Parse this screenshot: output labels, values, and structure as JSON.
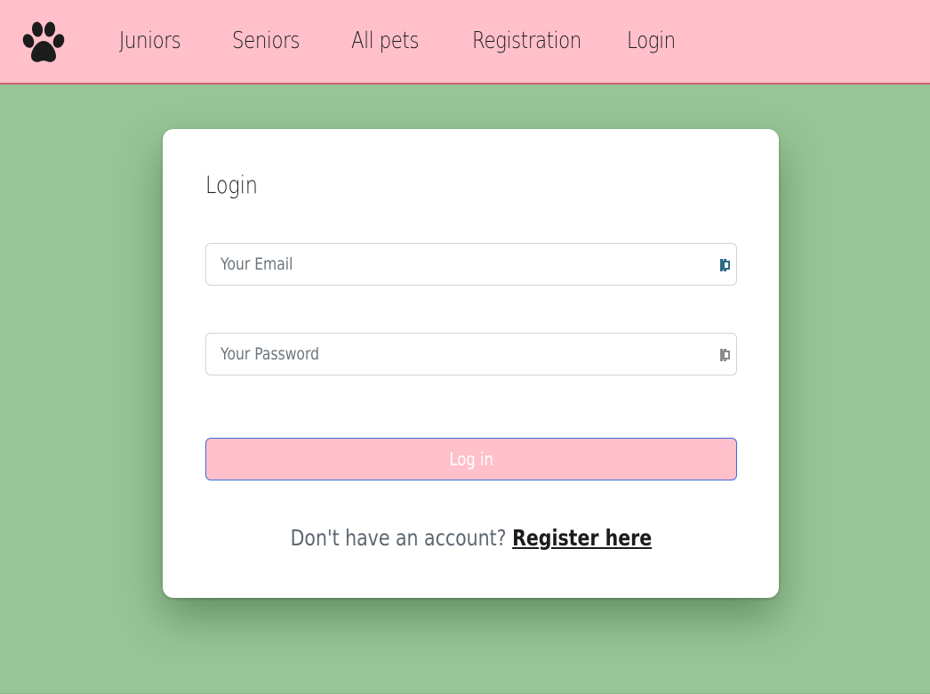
{
  "nav": {
    "logo_icon": "paw-icon",
    "links": [
      "Juniors",
      "Seniors",
      "All pets",
      "Registration",
      "Login"
    ]
  },
  "login_form": {
    "title": "Login",
    "email_placeholder": "Your Email",
    "password_placeholder": "Your Password",
    "password_manager_icon": "password-manager-icon",
    "submit_label": "Log in",
    "register_prompt": "Don't have an account?",
    "register_link": "Register here"
  },
  "colors": {
    "navbar_bg": "#ffc0cb",
    "page_bg": "#98c597",
    "card_bg": "#ffffff",
    "button_bg": "#ffc0cb",
    "button_border": "#3d6ce0",
    "email_icon": "#2a6b84",
    "password_icon": "#8a8a8a"
  }
}
